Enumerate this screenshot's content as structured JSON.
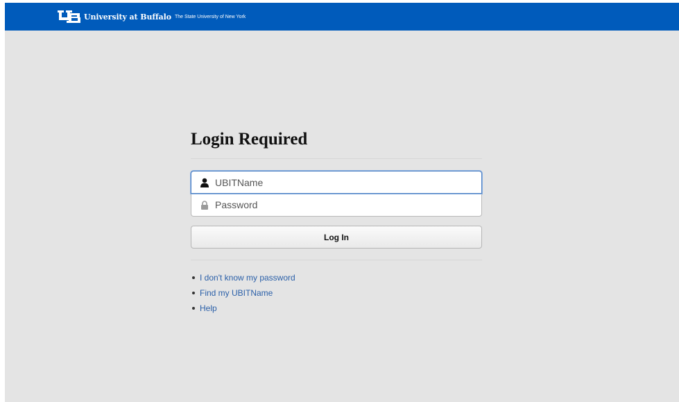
{
  "header": {
    "brand_name": "University at Buffalo",
    "brand_subtitle": "The State University of New York",
    "background_color": "#005bbb"
  },
  "login": {
    "title": "Login Required",
    "username": {
      "placeholder": "UBITName",
      "value": "",
      "icon": "user-icon"
    },
    "password": {
      "placeholder": "Password",
      "value": "",
      "icon": "lock-icon"
    },
    "submit_label": "Log In"
  },
  "links": [
    {
      "label": "I don't know my password"
    },
    {
      "label": "Find my UBITName"
    },
    {
      "label": "Help"
    }
  ],
  "colors": {
    "page_background": "#e4e4e4",
    "link": "#2a5fa8",
    "focus_border": "#4b7fc4"
  }
}
